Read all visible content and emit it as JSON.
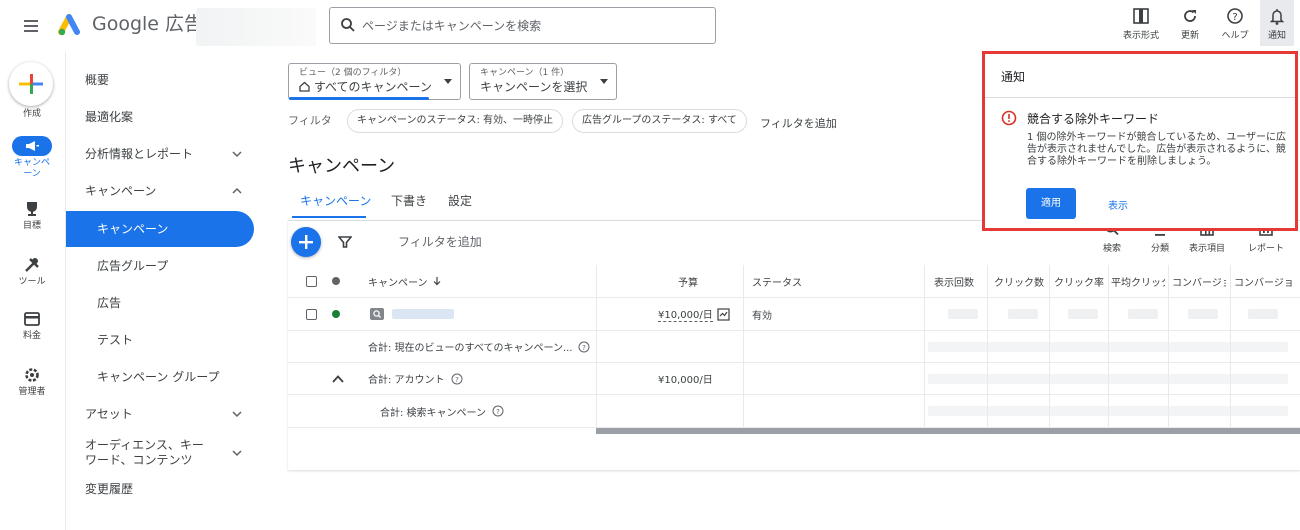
{
  "app": {
    "title": "Google 広告"
  },
  "search": {
    "placeholder": "ページまたはキャンペーンを検索"
  },
  "toolbar": {
    "appearance": "表示形式",
    "refresh": "更新",
    "help": "ヘルプ",
    "notifications": "通知"
  },
  "rail": {
    "create": "作成",
    "campaigns": "キャンペーン",
    "goals": "目標",
    "tools": "ツール",
    "billing": "料金",
    "admin": "管理者"
  },
  "sidebar": {
    "items": [
      "概要",
      "最適化案",
      "分析情報とレポート",
      "キャンペーン",
      "キャンペーン",
      "広告グループ",
      "広告",
      "テスト",
      "キャンペーン グループ",
      "アセット",
      "オーディエンス、キーワード、コンテンツ",
      "変更履歴"
    ]
  },
  "filters": {
    "view_label": "ビュー（2 個のフィルタ）",
    "view_value": "すべてのキャンペーン",
    "campaign_label": "キャンペーン（1 件）",
    "campaign_value": "キャンペーンを選択",
    "filter_label": "フィルタ",
    "chip1": "キャンペーンのステータス: 有効、一時停止",
    "chip2": "広告グループのステータス: すべて",
    "add_filter": "フィルタを追加"
  },
  "page": {
    "title": "キャンペーン",
    "tabs": [
      "キャンペーン",
      "下書き",
      "設定"
    ]
  },
  "table_toolbar": {
    "add_filter": "フィルタを追加",
    "search": "検索",
    "segment": "分類",
    "columns": "表示項目",
    "reports": "レポート"
  },
  "table": {
    "headers": {
      "campaign": "キャンペーン",
      "budget": "予算",
      "status": "ステータス",
      "impressions": "表示回数",
      "clicks": "クリック数",
      "ctr": "クリック率",
      "avg_cpc": "平均クリック",
      "conv1": "コンバージョン",
      "conv2": "コンバージョン"
    },
    "row1": {
      "budget": "¥10,000/日",
      "status": "有効"
    },
    "total_view": "合計: 現在のビューのすべてのキャンペーン...",
    "total_account": "合計: アカウント",
    "total_account_budget": "¥10,000/日",
    "total_search": "合計: 検索キャンペーン"
  },
  "notification": {
    "header": "通知",
    "title": "競合する除外キーワード",
    "body": "1 個の除外キーワードが競合しているため、ユーザーに広告が表示されませんでした。広告が表示されるように、競合する除外キーワードを削除しましょう。",
    "apply": "適用",
    "show": "表示"
  },
  "colors": {
    "accent": "#1a73e8",
    "highlight_border": "#e53935",
    "active_dot": "#188038"
  }
}
